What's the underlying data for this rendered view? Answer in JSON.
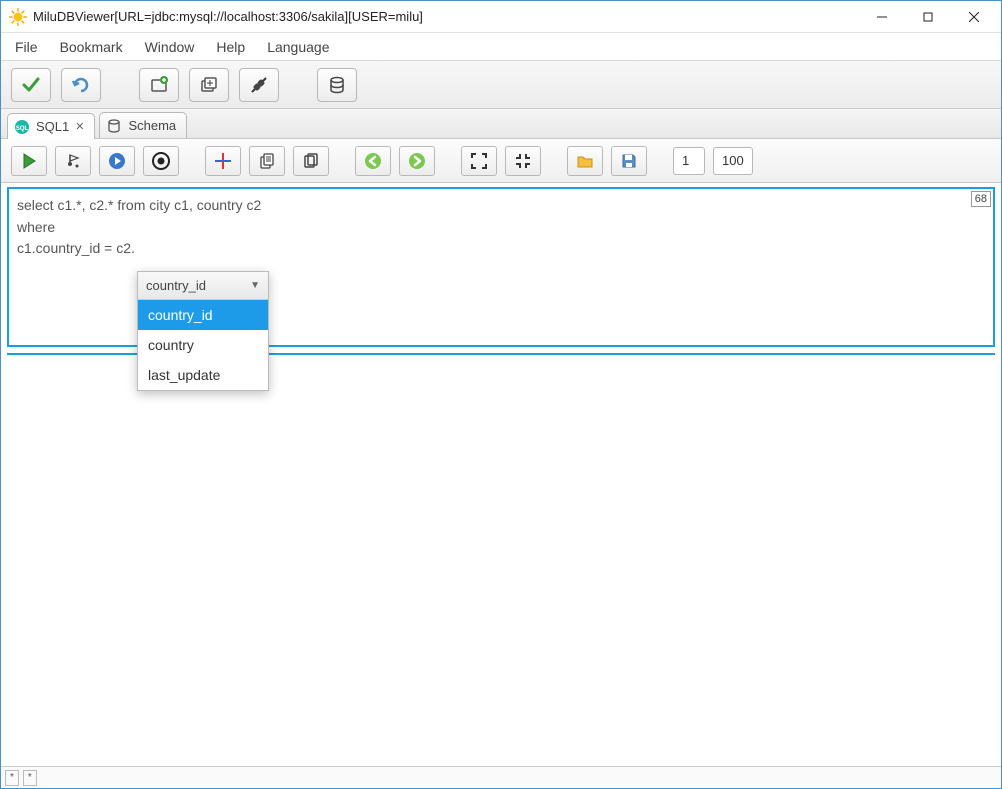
{
  "window": {
    "title": "MiluDBViewer[URL=jdbc:mysql://localhost:3306/sakila][USER=milu]"
  },
  "menu": {
    "file": "File",
    "bookmark": "Bookmark",
    "window": "Window",
    "help": "Help",
    "language": "Language"
  },
  "tabs": {
    "sql1": "SQL1",
    "schema": "Schema"
  },
  "page": {
    "from": "1",
    "to": "100"
  },
  "editor": {
    "text": "select c1.*, c2.* from city c1, country c2\nwhere\nc1.country_id = c2.",
    "counter": "68"
  },
  "autocomplete": {
    "header": "country_id",
    "items": [
      "country_id",
      "country",
      "last_update"
    ],
    "selected_index": 0
  },
  "statusbar": {
    "cell1": "*",
    "cell2": "*"
  }
}
